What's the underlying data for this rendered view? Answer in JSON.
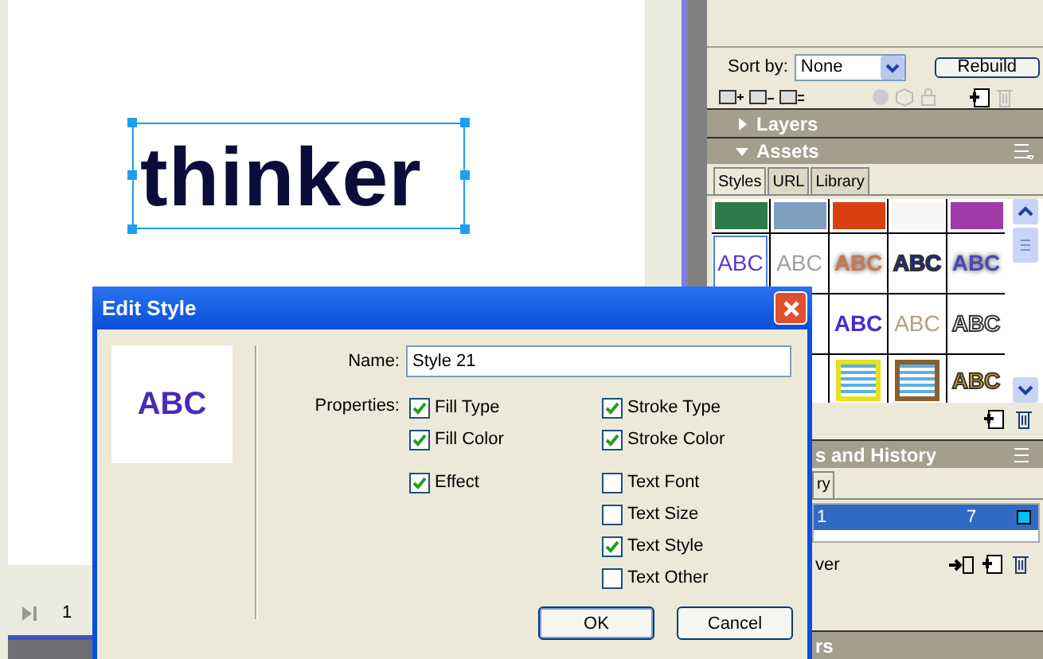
{
  "canvas": {
    "text": "thinker",
    "selected": true,
    "page_number": "1"
  },
  "panel": {
    "sort_label": "Sort by:",
    "sort_value": "None",
    "rebuild_button": "Rebuild",
    "sections": [
      {
        "title": "Layers",
        "expanded": false
      },
      {
        "title": "Assets",
        "expanded": true
      }
    ],
    "tabs": [
      {
        "label": "Styles",
        "selected": true
      },
      {
        "label": "URL",
        "selected": false
      },
      {
        "label": "Library",
        "selected": false
      }
    ],
    "styles": [
      {
        "kind": "fill",
        "color": "#2f7a4a",
        "selected": false
      },
      {
        "kind": "fill",
        "color": "#7f9fc0",
        "selected": false
      },
      {
        "kind": "fill",
        "color": "#d8400f",
        "selected": false
      },
      {
        "kind": "fill",
        "color": "#f6f6f6",
        "selected": false
      },
      {
        "kind": "fill",
        "color": "#a03aa8",
        "selected": false
      },
      {
        "kind": "text",
        "label": "ABC",
        "color": "#5a3cc8",
        "selected": true
      },
      {
        "kind": "text",
        "label": "ABC",
        "color": "#a0a0a0",
        "selected": false
      },
      {
        "kind": "glow",
        "label": "ABC",
        "color": "#c87850",
        "selected": false
      },
      {
        "kind": "outline",
        "label": "ABC",
        "color": "#1a2a8a",
        "selected": false
      },
      {
        "kind": "glow",
        "label": "ABC",
        "color": "#4a4ab0",
        "selected": false
      },
      {
        "kind": "blank"
      },
      {
        "kind": "partial"
      },
      {
        "kind": "bold",
        "label": "ABC",
        "color": "#4a2ad0",
        "selected": false
      },
      {
        "kind": "text",
        "label": "ABC",
        "color": "#b0a080",
        "selected": false
      },
      {
        "kind": "outline",
        "label": "ABC",
        "color": "#ffffff",
        "selected": false
      },
      {
        "kind": "blank"
      },
      {
        "kind": "partial"
      },
      {
        "kind": "box",
        "color": "#e8e020",
        "selected": false
      },
      {
        "kind": "box",
        "color": "#8a6030",
        "selected": false
      },
      {
        "kind": "outline",
        "label": "ABC",
        "color": "#e0a020",
        "selected": false
      }
    ],
    "frames": {
      "title": "s and History",
      "tab": "ry",
      "rows": [
        {
          "name": "1",
          "delay": "7",
          "selected": true
        }
      ],
      "footer": "ver"
    },
    "last_section": "rs"
  },
  "dialog": {
    "title": "Edit Style",
    "preview": "ABC",
    "name_label": "Name:",
    "name_value": "Style 21",
    "properties_label": "Properties:",
    "left_properties": [
      {
        "label": "Fill Type",
        "checked": true
      },
      {
        "label": "Fill Color",
        "checked": true
      },
      {
        "label": "Effect",
        "checked": true
      }
    ],
    "right_properties": [
      {
        "label": "Stroke Type",
        "checked": true
      },
      {
        "label": "Stroke Color",
        "checked": true
      },
      {
        "label": "Text Font",
        "checked": false
      },
      {
        "label": "Text Size",
        "checked": false
      },
      {
        "label": "Text Style",
        "checked": true
      },
      {
        "label": "Text Other",
        "checked": false
      }
    ],
    "buttons": [
      "OK",
      "Cancel"
    ]
  }
}
